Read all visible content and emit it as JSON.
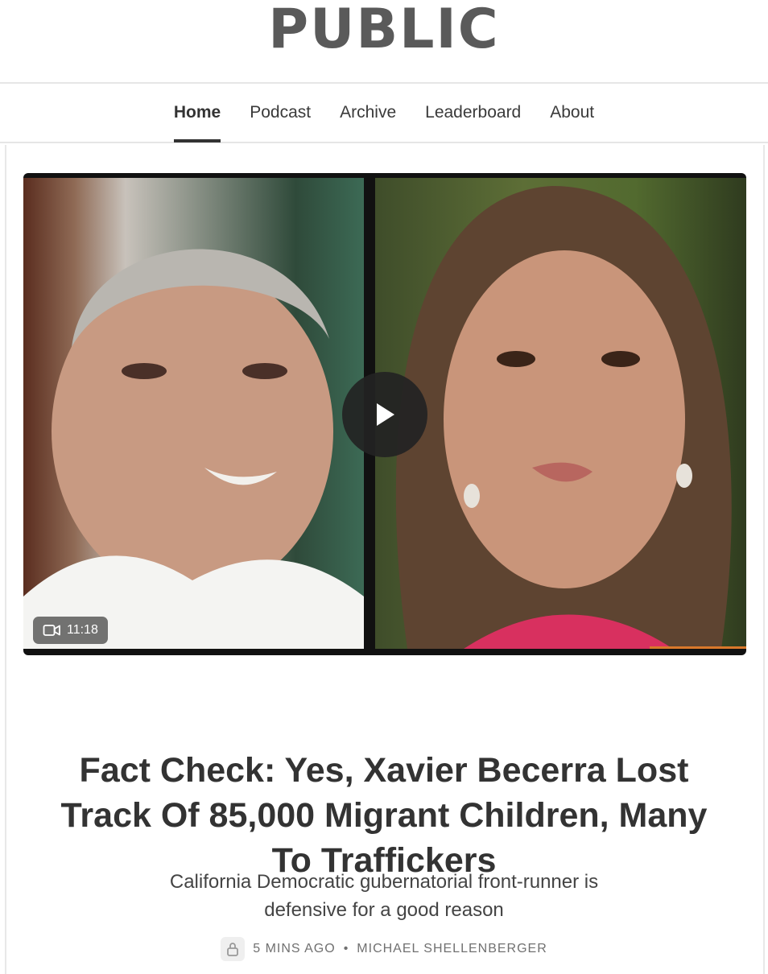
{
  "site": {
    "logo": "PUBLIC"
  },
  "nav": {
    "items": [
      {
        "label": "Home",
        "active": true
      },
      {
        "label": "Podcast"
      },
      {
        "label": "Archive"
      },
      {
        "label": "Leaderboard"
      },
      {
        "label": "About"
      }
    ]
  },
  "video": {
    "duration": "11:18",
    "icon": "video-camera-icon",
    "play_icon": "play-icon"
  },
  "article": {
    "title": "Fact Check: Yes, Xavier Becerra Lost Track Of 85,000 Migrant Children, Many To Traffickers",
    "subtitle": "California Democratic gubernatorial front-runner is defensive for a good reason",
    "time": "5 MINS AGO",
    "separator": "•",
    "author": "MICHAEL SHELLENBERGER",
    "lock_icon": "lock-icon"
  },
  "colors": {
    "accent": "#d9782b",
    "text": "#333333",
    "divider": "#e6e6e6"
  }
}
